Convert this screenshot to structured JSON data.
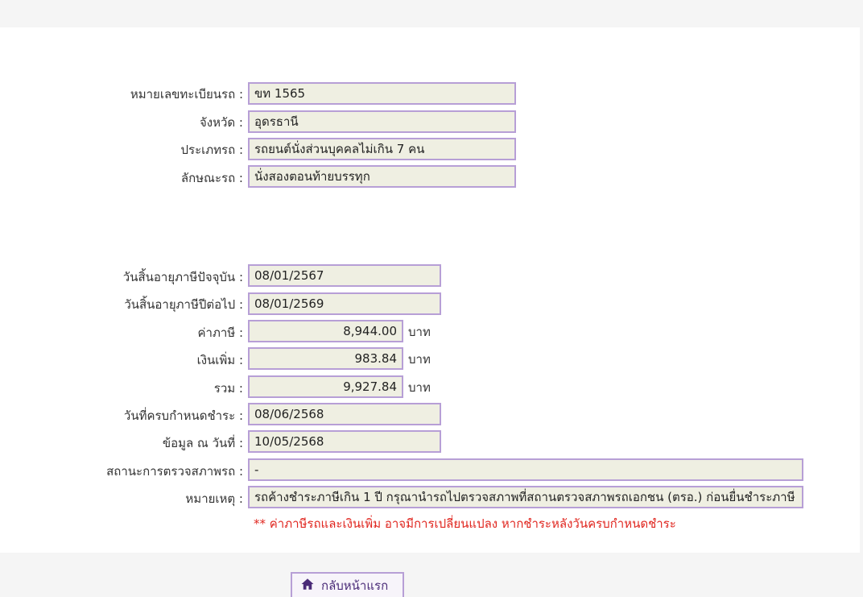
{
  "vehicle": {
    "plate_label": "หมายเลขทะเบียนรถ :",
    "plate_value": "ขท 1565",
    "province_label": "จังหวัด :",
    "province_value": "อุดรธานี",
    "type_label": "ประเภทรถ :",
    "type_value": "รถยนต์นั่งส่วนบุคคลไม่เกิน 7 คน",
    "body_label": "ลักษณะรถ :",
    "body_value": "นั่งสองตอนท้ายบรรทุก"
  },
  "tax": {
    "current_expiry_label": "วันสิ้นอายุภาษีปัจจุบัน :",
    "current_expiry_value": "08/01/2567",
    "next_expiry_label": "วันสิ้นอายุภาษีปีต่อไป :",
    "next_expiry_value": "08/01/2569",
    "tax_label": "ค่าภาษี :",
    "tax_value": "8,944.00",
    "surcharge_label": "เงินเพิ่ม :",
    "surcharge_value": "983.84",
    "total_label": "รวม :",
    "total_value": "9,927.84",
    "unit": "บาท",
    "due_label": "วันที่ครบกำหนดชำระ :",
    "due_value": "08/06/2568",
    "as_of_label": "ข้อมูล ณ วันที่ :",
    "as_of_value": "10/05/2568",
    "inspection_label": "สถานะการตรวจสภาพรถ :",
    "inspection_value": "-",
    "remark_label": "หมายเหตุ :",
    "remark_value": "รถค้างชำระภาษีเกิน 1 ปี กรุณานำรถไปตรวจสภาพที่สถานตรวจสภาพรถเอกชน (ตรอ.) ก่อนยื่นชำระภาษี",
    "warning": "** ค่าภาษีรถและเงินเพิ่ม อาจมีการเปลี่ยนแปลง หากชำระหลังวันครบกำหนดชำระ"
  },
  "nav": {
    "home_label": "กลับหน้าแรก"
  },
  "colors": {
    "field_bg": "#efefe2",
    "field_border": "#b79fd6",
    "warning": "#e0261f"
  }
}
